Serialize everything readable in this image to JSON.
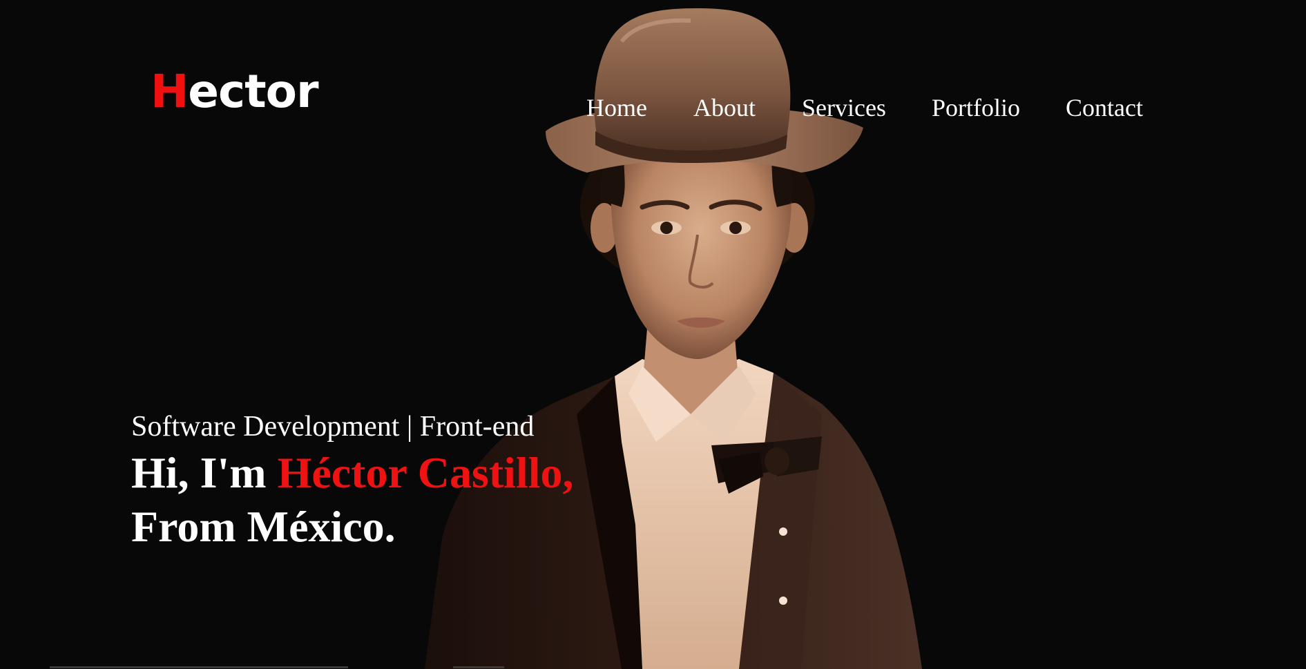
{
  "logo": {
    "mark": "H",
    "rest": "ector"
  },
  "nav": {
    "items": [
      {
        "label": "Home"
      },
      {
        "label": "About"
      },
      {
        "label": "Services"
      },
      {
        "label": "Portfolio"
      },
      {
        "label": "Contact"
      }
    ]
  },
  "hero": {
    "subtitle": "Software Development | Front-end",
    "greeting": "Hi, I'm ",
    "name": "Héctor Castillo,",
    "origin": "From México."
  },
  "colors": {
    "background": "#080808",
    "accent": "#ee1212",
    "text": "#ffffff"
  },
  "portrait": {
    "icon": "portrait-illustration"
  }
}
